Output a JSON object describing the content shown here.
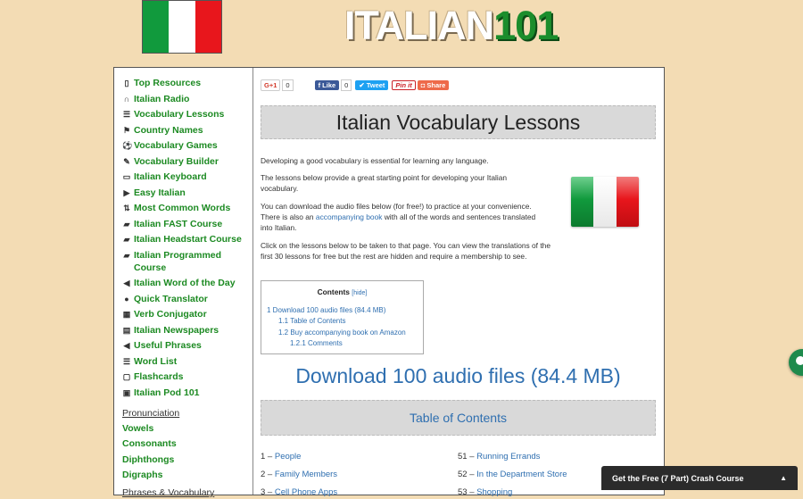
{
  "header": {
    "logo_text": "ITALIAN",
    "logo_num": "101"
  },
  "sidebar": {
    "items": [
      {
        "icon": "bookmark-icon",
        "glyph": "▯",
        "label": "Top Resources"
      },
      {
        "icon": "headphones-icon",
        "glyph": "∩",
        "label": "Italian Radio"
      },
      {
        "icon": "list-icon",
        "glyph": "☰",
        "label": "Vocabulary Lessons"
      },
      {
        "icon": "flag-icon",
        "glyph": "⚑",
        "label": "Country Names"
      },
      {
        "icon": "soccer-icon",
        "glyph": "⚽",
        "label": "Vocabulary Games"
      },
      {
        "icon": "edit-icon",
        "glyph": "✎",
        "label": "Vocabulary Builder"
      },
      {
        "icon": "keyboard-icon",
        "glyph": "▭",
        "label": "Italian Keyboard"
      },
      {
        "icon": "play-icon",
        "glyph": "▶",
        "label": "Easy Italian"
      },
      {
        "icon": "sort-icon",
        "glyph": "⇅",
        "label": "Most Common Words"
      },
      {
        "icon": "book-icon",
        "glyph": "▰",
        "label": "Italian FAST Course"
      },
      {
        "icon": "book-icon",
        "glyph": "▰",
        "label": "Italian Headstart Course"
      },
      {
        "icon": "book-icon",
        "glyph": "▰",
        "label": "Italian Programmed Course"
      },
      {
        "icon": "volume-icon",
        "glyph": "◀",
        "label": "Italian Word of the Day"
      },
      {
        "icon": "comment-icon",
        "glyph": "●",
        "label": "Quick Translator"
      },
      {
        "icon": "table-icon",
        "glyph": "▦",
        "label": "Verb Conjugator"
      },
      {
        "icon": "newspaper-icon",
        "glyph": "▤",
        "label": "Italian Newspapers"
      },
      {
        "icon": "volume-icon",
        "glyph": "◀",
        "label": "Useful Phrases"
      },
      {
        "icon": "list-icon",
        "glyph": "☰",
        "label": "Word List"
      },
      {
        "icon": "square-icon",
        "glyph": "▢",
        "label": "Flashcards"
      },
      {
        "icon": "id-card-icon",
        "glyph": "▣",
        "label": "Italian Pod 101"
      }
    ],
    "section_title": "Pronunciation",
    "section_items": [
      "Vowels",
      "Consonants",
      "Diphthongs",
      "Digraphs"
    ],
    "cut_off_text": "Phrases & Vocabulary"
  },
  "social": {
    "gplus": "G+1",
    "gplus_count": "0",
    "like": "Like",
    "like_count": "0",
    "tweet": "Tweet",
    "pin": "Pin it",
    "share": "Share"
  },
  "main": {
    "title": "Italian Vocabulary Lessons",
    "p1": "Developing a good vocabulary is essential for learning any language.",
    "p2": "The lessons below provide a great starting point for developing your Italian vocabulary.",
    "p3a": "You can download the audio files below (for free!) to practice at your convenience. There is also an ",
    "p3link": "accompanying book",
    "p3b": " with all of the words and sentences translated into Italian.",
    "p4": "Click on the lessons below to be taken to that page. You can view the translations of the first 30 lessons for free but the rest are hidden and require a membership to see."
  },
  "toc": {
    "title": "Contents",
    "hide": "[hide]",
    "items": [
      "1 Download 100 audio files (84.4 MB)",
      "1.1 Table of Contents",
      "1.2 Buy accompanying book on Amazon",
      "1.2.1 Comments"
    ]
  },
  "download_heading": "Download 100 audio files (84.4 MB)",
  "toc_heading": "Table of Contents",
  "lessons": [
    {
      "num": "1 –",
      "name": "People"
    },
    {
      "num": "2 –",
      "name": "Family Members"
    },
    {
      "num": "3 –",
      "name": "Cell Phone Apps"
    },
    {
      "num": "51 –",
      "name": "Running Errands"
    },
    {
      "num": "52 –",
      "name": "In the Department Store"
    },
    {
      "num": "53 –",
      "name": "Shopping"
    }
  ],
  "crash_course": "Get the Free (7 Part) Crash Course"
}
